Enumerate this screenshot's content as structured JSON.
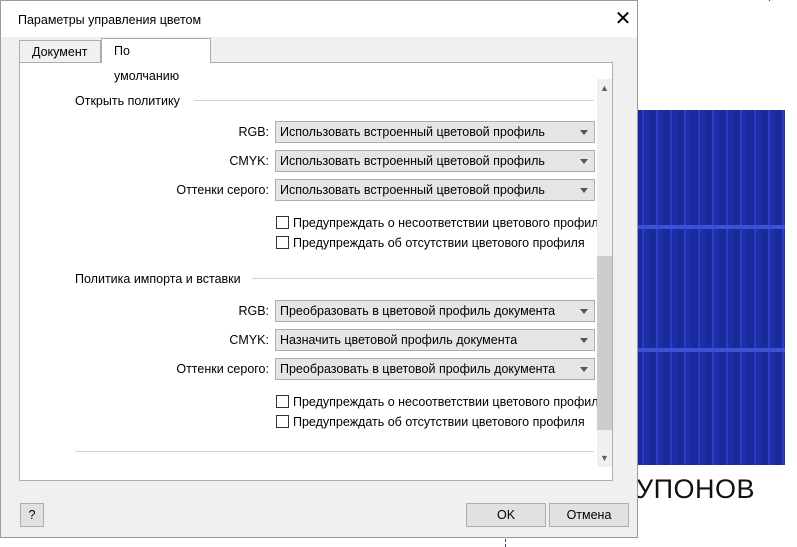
{
  "dialog": {
    "title": "Параметры управления цветом",
    "close_glyph": "✕"
  },
  "tabs": [
    {
      "label": "Документ"
    },
    {
      "label": "По умолчанию"
    }
  ],
  "sections": [
    {
      "title": "Открыть политику",
      "rows": [
        {
          "label": "RGB:",
          "value": "Использовать встроенный цветовой профиль"
        },
        {
          "label": "CMYK:",
          "value": "Использовать встроенный цветовой профиль"
        },
        {
          "label": "Оттенки серого:",
          "value": "Использовать встроенный цветовой профиль"
        }
      ],
      "checks": [
        {
          "label": "Предупреждать о несоответствии цветового профиля",
          "checked": false
        },
        {
          "label": "Предупреждать об отсутствии цветового профиля",
          "checked": false
        }
      ]
    },
    {
      "title": "Политика импорта и вставки",
      "rows": [
        {
          "label": "RGB:",
          "value": "Преобразовать в цветовой профиль документа"
        },
        {
          "label": "CMYK:",
          "value": "Назначить цветовой профиль документа"
        },
        {
          "label": "Оттенки серого:",
          "value": "Преобразовать в цветовой профиль документа"
        }
      ],
      "checks": [
        {
          "label": "Предупреждать о несоответствии цветового профиля",
          "checked": false
        },
        {
          "label": "Предупреждать об отсутствии цветового профиля",
          "checked": false
        }
      ]
    }
  ],
  "buttons": {
    "help": "?",
    "ok": "OK",
    "cancel": "Отмена"
  },
  "background": {
    "text": "УПОНОВ"
  },
  "icons": {
    "scroll_up": "chevron-up-icon",
    "scroll_down": "chevron-down-icon",
    "combo": "dropdown-arrow-icon"
  },
  "colors": {
    "dialog_bg": "#f0f0f0",
    "panel_bg": "#ffffff",
    "bg_blue": "#1a2a9a"
  }
}
